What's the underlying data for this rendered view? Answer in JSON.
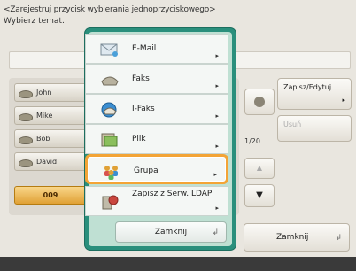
{
  "header": {
    "line1": "<Zarejestruj przycisk wybierania jednoprzyciskowego>",
    "line2": "Wybierz temat."
  },
  "list": {
    "items": [
      "John",
      "Mike",
      "Bob",
      "David"
    ],
    "selected": "009"
  },
  "right_panel": {
    "edit_label": "Zapisz/Edytuj",
    "delete_label": "Usuń",
    "page": "1/20",
    "close_label": "Zamknij"
  },
  "popup": {
    "items": [
      {
        "label": "E-Mail",
        "icon": "email-icon"
      },
      {
        "label": "Faks",
        "icon": "fax-icon"
      },
      {
        "label": "I-Faks",
        "icon": "ifax-icon"
      },
      {
        "label": "Plik",
        "icon": "file-icon"
      },
      {
        "label": "Grupa",
        "icon": "group-icon"
      },
      {
        "label": "Zapisz z Serw. LDAP",
        "icon": "ldap-icon"
      }
    ],
    "highlighted": "Grupa",
    "close_label": "Zamknij"
  },
  "colors": {
    "popup_border": "#2a8f7c",
    "highlight": "#f3a436",
    "selected_item": "#e0a136"
  }
}
